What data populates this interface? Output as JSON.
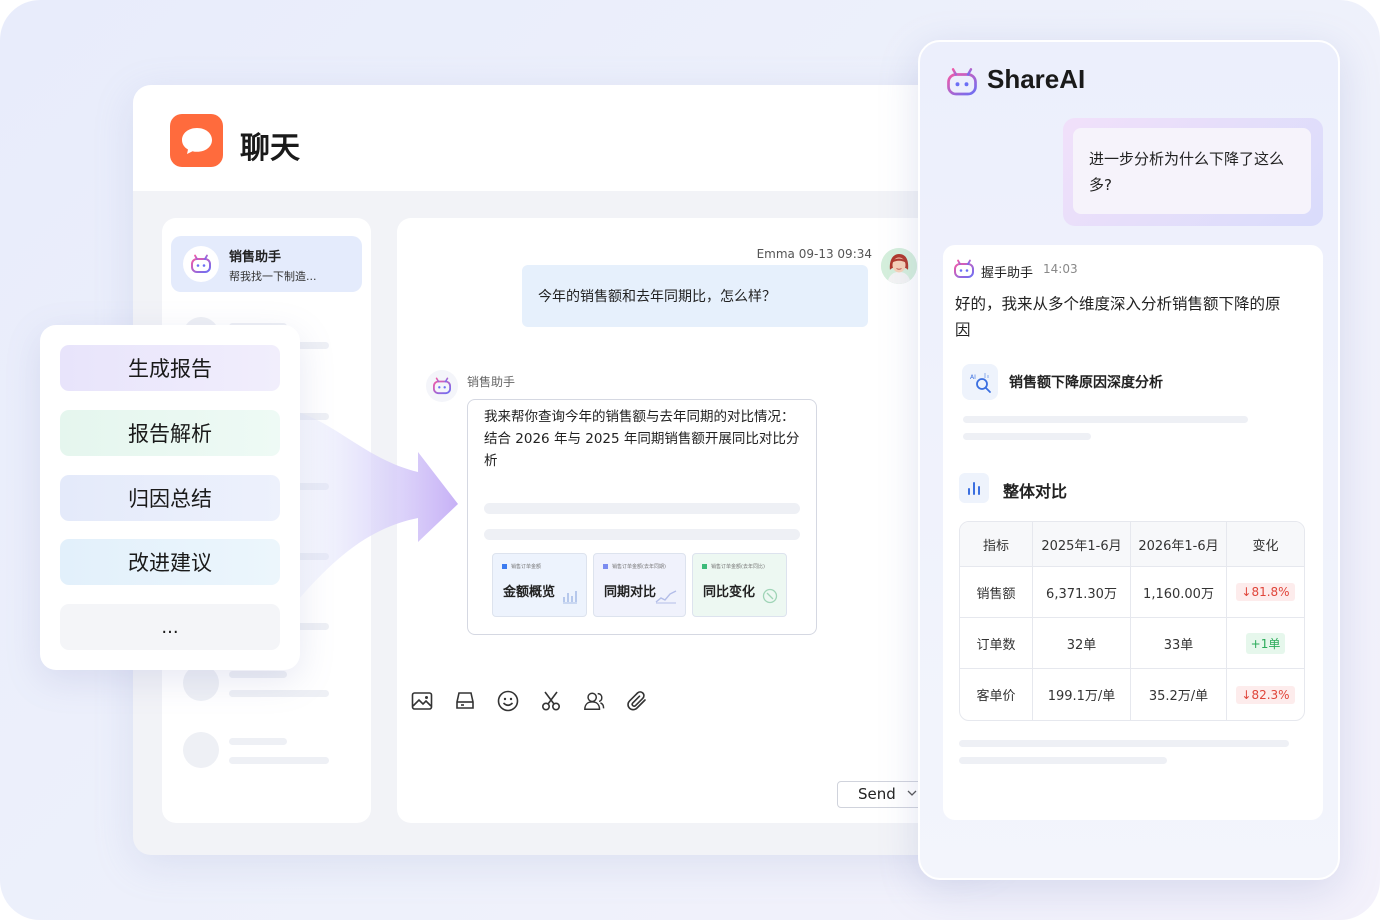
{
  "app": {
    "title": "聊天"
  },
  "sidebar": {
    "active_conversation": {
      "name": "销售助手",
      "preview": "帮我找一下制造..."
    }
  },
  "chat": {
    "user_message": {
      "sender": "Emma",
      "timestamp": "09-13 09:34",
      "text": "今年的销售额和去年同期比，怎么样？"
    },
    "bot_message": {
      "sender": "销售助手",
      "text_line1": "我来帮你查询今年的销售额与去年同期的对比情况：",
      "text_line2": "结合 2026 年与 2025 年同期销售额开展同比对比分析",
      "cards": [
        {
          "subtitle": "销售订单金额",
          "title": "金额概览",
          "color": "#3b7bf0"
        },
        {
          "subtitle": "销售订单金额(去年同期)",
          "title": "同期对比",
          "color": "#7b8cf0"
        },
        {
          "subtitle": "销售订单金额(去年同比)",
          "title": "同比变化",
          "color": "#3dbb7a"
        }
      ]
    },
    "toolbar_icons": [
      "image-icon",
      "storage-icon",
      "emoji-icon",
      "scissors-icon",
      "users-icon",
      "attachment-icon"
    ],
    "send_label": "Send"
  },
  "menu": {
    "items": [
      {
        "label": "生成报告",
        "color": "#ece7fb"
      },
      {
        "label": "报告解析",
        "color": "#e8f7f1"
      },
      {
        "label": "归因总结",
        "color": "#e8eefb"
      },
      {
        "label": "改进建议",
        "color": "#e6f3fb"
      },
      {
        "label": "...",
        "color": "#f4f5f8"
      }
    ]
  },
  "share_panel": {
    "brand": "ShareAI",
    "question": "进一步分析为什么下降了这么多?",
    "answer": {
      "sender": "握手助手",
      "time": "14:03",
      "text": "好的，我来从多个维度深入分析销售额下降的原因",
      "report_title": "销售额下降原因深度分析",
      "section_title": "整体对比",
      "table": {
        "headers": [
          "指标",
          "2025年1-6月",
          "2026年1-6月",
          "变化"
        ],
        "rows": [
          {
            "metric": "销售额",
            "v2025": "6,371.30万",
            "v2026": "1,160.00万",
            "change": "↓81.8%",
            "direction": "down"
          },
          {
            "metric": "订单数",
            "v2025": "32单",
            "v2026": "33单",
            "change": "+1单",
            "direction": "up"
          },
          {
            "metric": "客单价",
            "v2025": "199.1万/单",
            "v2026": "35.2万/单",
            "change": "↓82.3%",
            "direction": "down"
          }
        ]
      }
    }
  },
  "colors": {
    "accent_orange": "#ff6b3d",
    "user_bubble": "#e6f0fc",
    "down": "#e0453a",
    "up": "#2bab5a"
  }
}
